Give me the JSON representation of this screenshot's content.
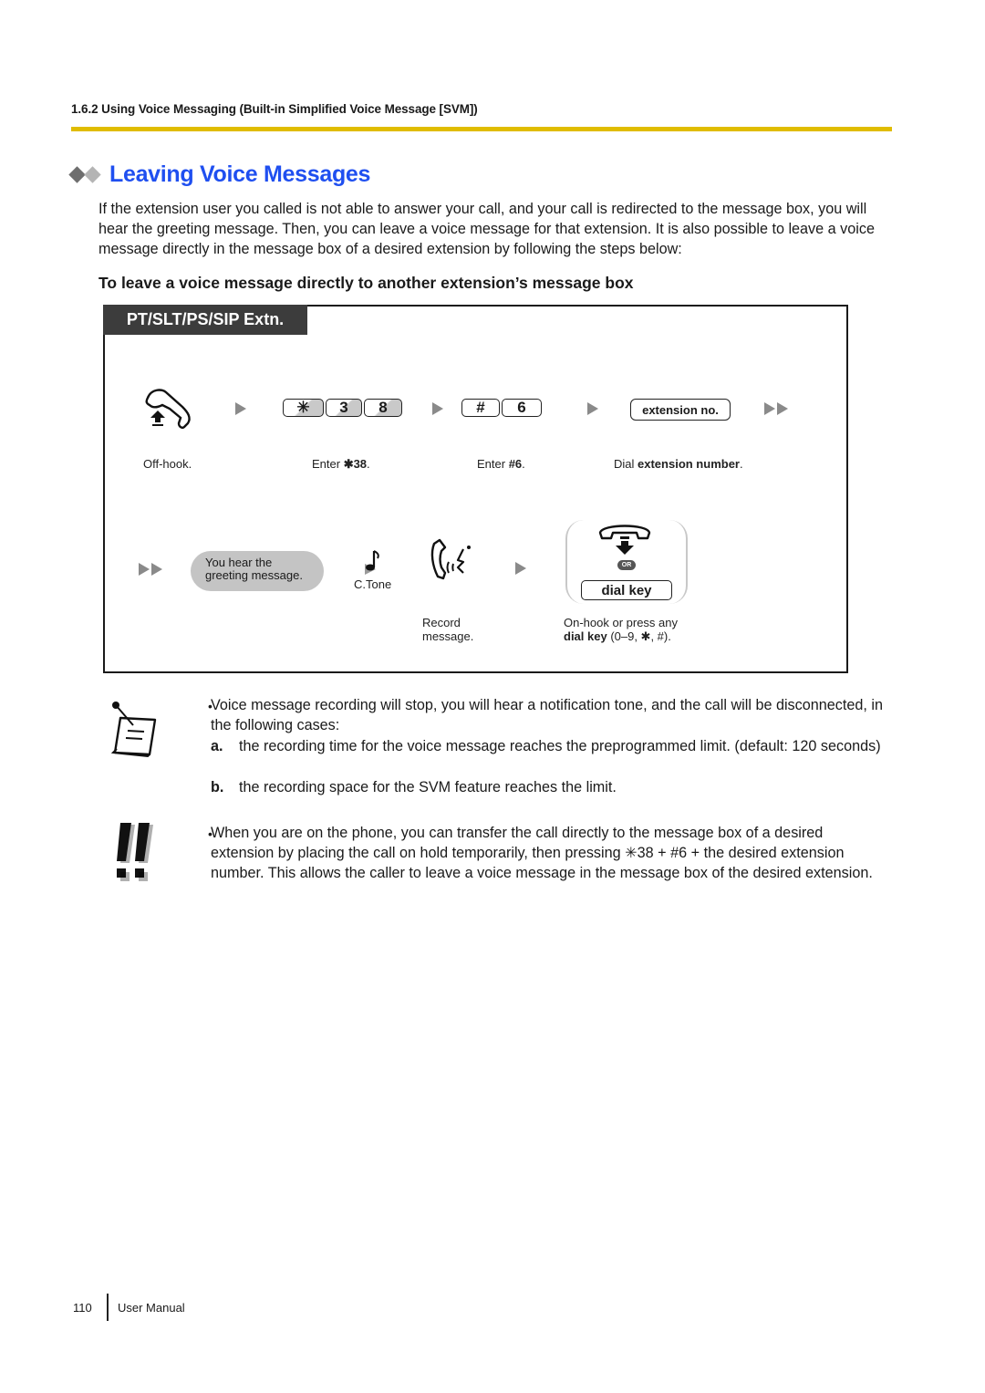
{
  "header": {
    "running_head": "1.6.2 Using Voice Messaging (Built-in Simplified Voice Message [SVM])",
    "rule_color": "#e0bc00"
  },
  "section": {
    "title": "Leaving Voice Messages",
    "title_color": "#1f4ff0",
    "intro": "If the extension user you called is not able to answer your call, and your call is redirected to the message box, you will hear the greeting message. Then, you can leave a voice message for that extension. It is also possible to leave a voice message directly in the message box of a desired extension by following the steps below:",
    "subheading": "To leave a voice message directly to another extension’s message box"
  },
  "procedure": {
    "tab_label": "PT/SLT/PS/SIP Extn.",
    "row1": {
      "step1": {
        "icon": "off-hook-handset-icon",
        "caption": "Off-hook."
      },
      "step2": {
        "keys": [
          "✳",
          "3",
          "8"
        ],
        "caption_prefix": "Enter ",
        "caption_bold": "✱38",
        "caption_suffix": "."
      },
      "step3": {
        "keys": [
          "#",
          "6"
        ],
        "caption_prefix": "Enter ",
        "caption_bold": "#6",
        "caption_suffix": "."
      },
      "step4": {
        "key_label": "extension no.",
        "caption_prefix": "Dial ",
        "caption_bold": "extension number",
        "caption_suffix": "."
      }
    },
    "row2": {
      "bubble_line1": "You hear the",
      "bubble_line2": "greeting message.",
      "tone_label": "C.Tone",
      "record_caption_line1": "Record",
      "record_caption_line2": "message.",
      "or_label": "OR",
      "dial_key_label": "dial key",
      "end_caption_line1": "On-hook or press any",
      "end_caption_bold": "dial key",
      "end_caption_rest": " (0–9, ✱, #)."
    }
  },
  "notes": {
    "note1": {
      "bullet": "•",
      "text": "Voice message recording will stop, you will hear a notification tone, and the call will be disconnected, in the following cases:",
      "items": [
        {
          "marker": "a.",
          "text": "the recording time for the voice message reaches the preprogrammed limit. (default: 120 seconds)"
        },
        {
          "marker": "b.",
          "text": "the recording space for the SVM feature reaches the limit."
        }
      ]
    },
    "note2": {
      "bullet": "•",
      "text": "When you are on the phone, you can transfer the call directly to the message box of a desired extension by placing the call on hold temporarily, then pressing ✳38 + #6 + the desired extension number. This allows the caller to leave a voice message in the message box of the desired extension."
    }
  },
  "footer": {
    "page_number": "110",
    "label": "User Manual"
  }
}
